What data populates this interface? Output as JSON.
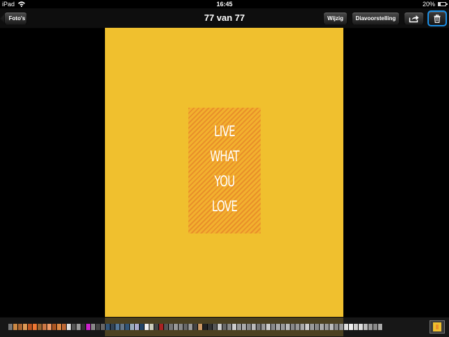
{
  "status_bar": {
    "device": "iPad",
    "time": "16:45",
    "battery": "20%",
    "wifi_icon": "wifi-icon",
    "battery_icon": "battery-icon"
  },
  "nav": {
    "back_label": "Foto's",
    "title": "77 van 77",
    "edit_label": "Wijzig",
    "slideshow_label": "Diavoorstelling",
    "share_icon": "share-icon",
    "trash_icon": "trash-icon",
    "highlight_color": "#1b8fe6"
  },
  "photo": {
    "background_color": "#f0c02e",
    "stripe_color": "#e9902a",
    "lines": [
      "LIVE",
      "WHAT",
      "YOU",
      "LOVE"
    ]
  },
  "filmstrip": {
    "thumb_count": 77,
    "current_index": 77,
    "thumb_colors": [
      "#777",
      "#c84",
      "#a63",
      "#d95",
      "#b52",
      "#e73",
      "#963",
      "#c74",
      "#e96",
      "#a52",
      "#d84",
      "#b63",
      "#ddd",
      "#555",
      "#999",
      "#333",
      "#c2c",
      "#888",
      "#444",
      "#666",
      "#357",
      "#345",
      "#579",
      "#678",
      "#357",
      "#9ab",
      "#aac",
      "#246",
      "#eee",
      "#ccb",
      "#444",
      "#a22",
      "#555",
      "#777",
      "#999",
      "#888",
      "#666",
      "#999",
      "#444",
      "#c96",
      "#222",
      "#333",
      "#555",
      "#ccc",
      "#666",
      "#888",
      "#ccc",
      "#999",
      "#aaa",
      "#888",
      "#bbb",
      "#777",
      "#999",
      "#ccc",
      "#888",
      "#aaa",
      "#999",
      "#bbb",
      "#888",
      "#999",
      "#aaa",
      "#ccc",
      "#999",
      "#888",
      "#aaa",
      "#999",
      "#bbb",
      "#888",
      "#999",
      "#ddd",
      "#eee",
      "#ccc",
      "#ddd",
      "#bbb",
      "#999",
      "#888",
      "#aaa"
    ]
  }
}
